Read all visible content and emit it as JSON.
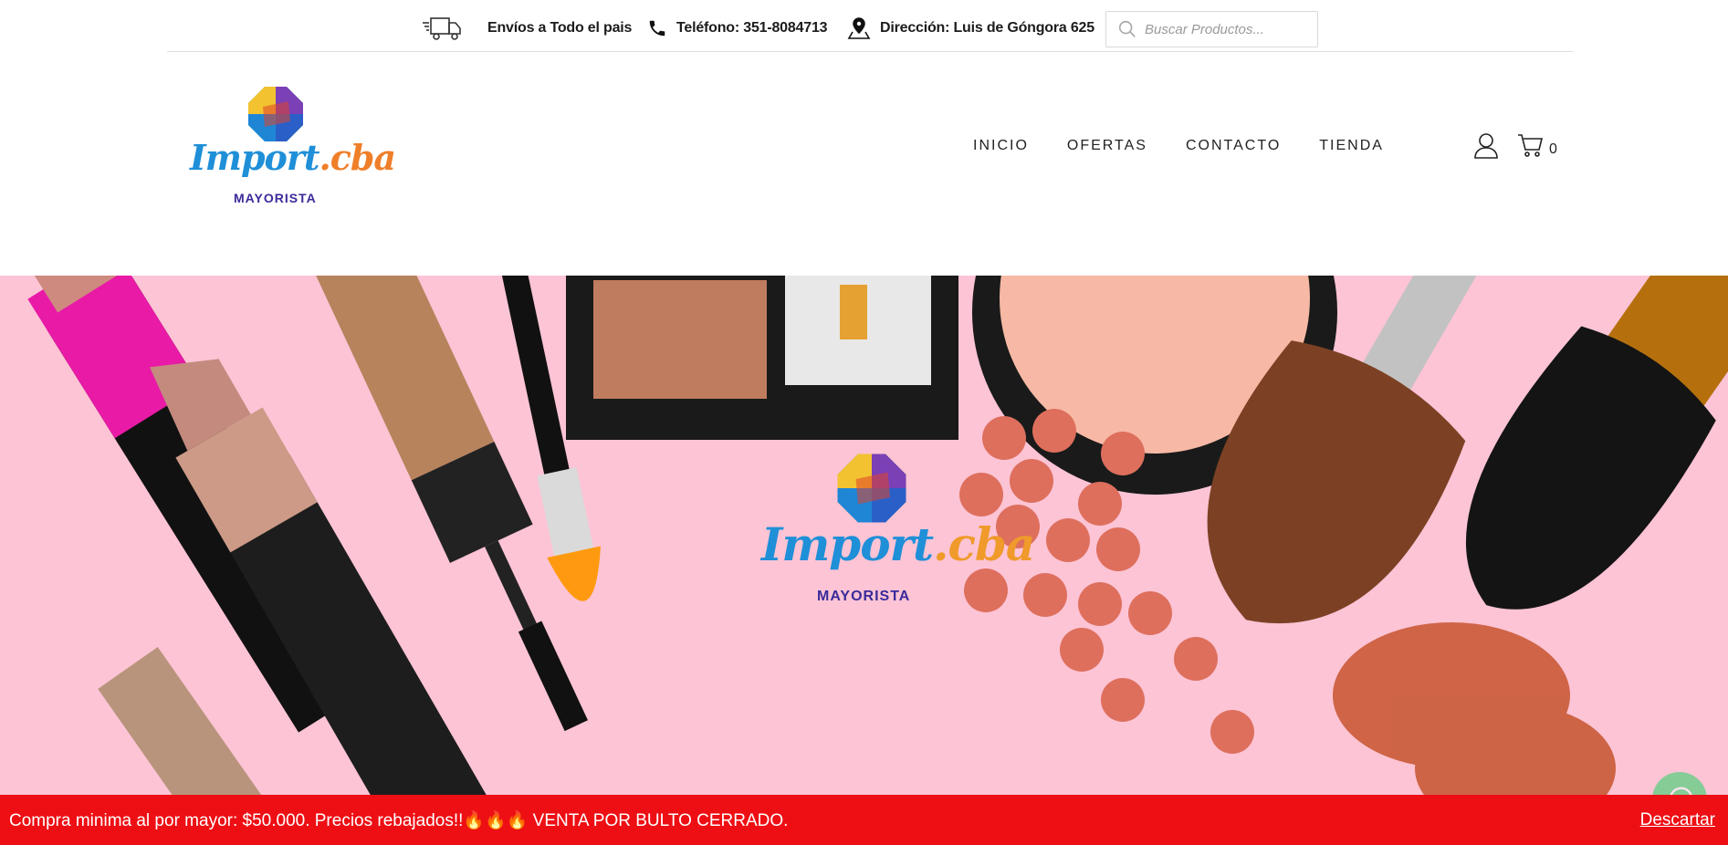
{
  "topbar": {
    "shipping": "Envíos a Todo el pais",
    "phone": "Teléfono: 351-8084713",
    "address": "Dirección: Luis de Góngora 625",
    "search_placeholder": "Buscar Productos..."
  },
  "brand": {
    "name_part1": "Import",
    "name_part2": ".cba",
    "tagline": "MAYORISTA"
  },
  "nav": {
    "items": [
      "INICIO",
      "OFERTAS",
      "CONTACTO",
      "TIENDA"
    ]
  },
  "header_icons": {
    "account_icon": "user-icon",
    "cart_icon": "cart-icon",
    "cart_count": "0"
  },
  "hero": {
    "background_color": "#fcc4d5",
    "logo_name_part1": "Import",
    "logo_name_part2": ".cba",
    "logo_tagline": "MAYORISTA"
  },
  "notice": {
    "text": "Compra minima al por mayor: $50.000. Precios rebajados!!🔥🔥🔥 VENTA POR BULTO CERRADO.",
    "dismiss": "Descartar",
    "background_color": "#ed0f14"
  },
  "whatsapp": {
    "icon": "whatsapp-icon"
  }
}
